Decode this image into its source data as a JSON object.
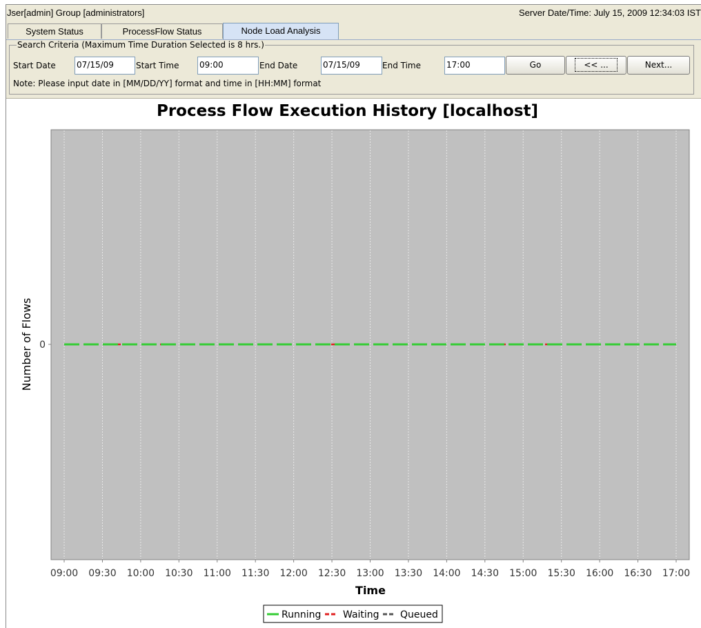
{
  "header": {
    "user_info": "Jser[admin]  Group [administrators]",
    "server_datetime": "Server Date/Time:  July 15, 2009 12:34:03 IST"
  },
  "tabs": [
    {
      "label": "System Status",
      "active": false
    },
    {
      "label": "ProcessFlow Status",
      "active": false
    },
    {
      "label": "Node Load Analysis",
      "active": true
    }
  ],
  "search": {
    "legend": "Search Criteria (Maximum Time Duration Selected is 8 hrs.)",
    "start_date_label": "Start Date",
    "start_date_value": "07/15/09",
    "start_time_label": "Start Time",
    "start_time_value": "09:00",
    "end_date_label": "End Date",
    "end_date_value": "07/15/09",
    "end_time_label": "End Time",
    "end_time_value": "17:00",
    "go_label": "Go",
    "prev_label": "<< ...",
    "next_label": "Next...",
    "note": "Note: Please input date in [MM/DD/YY] format and time in [HH:MM] format"
  },
  "chart_data": {
    "type": "line",
    "title": "Process Flow Execution History [localhost]",
    "xlabel": "Time",
    "ylabel": "Number of Flows",
    "x_ticks": [
      "09:00",
      "09:30",
      "10:00",
      "10:30",
      "11:00",
      "11:30",
      "12:00",
      "12:30",
      "13:00",
      "13:30",
      "14:00",
      "14:30",
      "15:00",
      "15:30",
      "16:00",
      "16:30",
      "17:00"
    ],
    "y_ticks": [
      "0"
    ],
    "grid": true,
    "legend_position": "bottom",
    "series": [
      {
        "name": "Running",
        "color": "#33cc33",
        "style": "solid",
        "x": [
          "09:00",
          "17:00"
        ],
        "values": [
          0,
          0
        ]
      },
      {
        "name": "Waiting",
        "color": "#e02020",
        "style": "dashed",
        "x": [
          "09:00",
          "17:00"
        ],
        "values": [
          0,
          0
        ]
      },
      {
        "name": "Queued",
        "color": "#555555",
        "style": "dashed",
        "x": [
          "09:00",
          "17:00"
        ],
        "values": [
          0,
          0
        ]
      }
    ]
  }
}
